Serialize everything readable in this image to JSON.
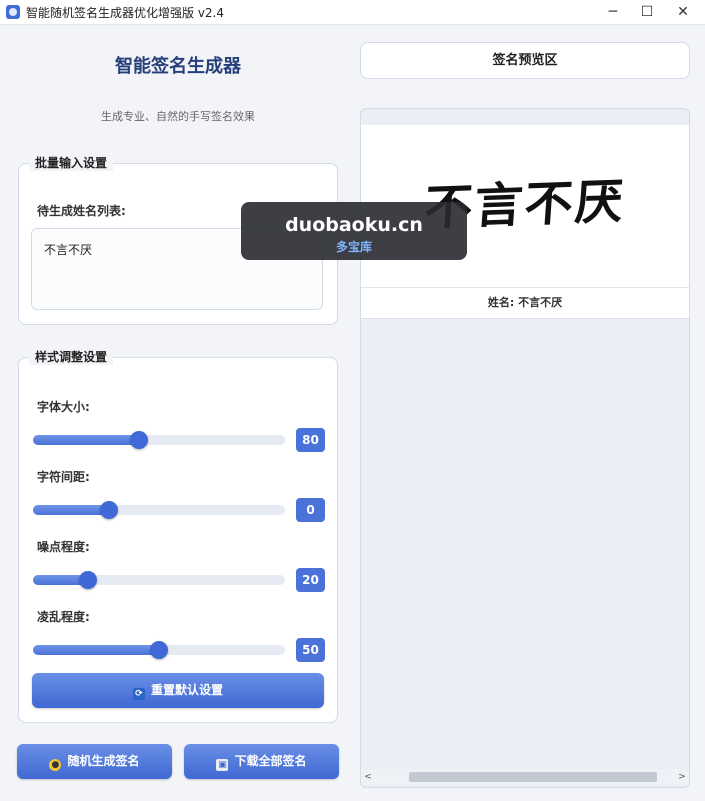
{
  "window": {
    "title": "智能随机签名生成器优化增强版 v2.4",
    "controls": {
      "minimize": "─",
      "maximize": "☐",
      "close": "✕"
    }
  },
  "header": {
    "title": "智能签名生成器",
    "subtitle": "生成专业、自然的手写签名效果"
  },
  "batch_input": {
    "group_title": "批量输入设置",
    "label": "待生成姓名列表:",
    "value": "不言不厌"
  },
  "style_settings": {
    "group_title": "样式调整设置",
    "sliders": [
      {
        "label": "字体大小:",
        "value": "80",
        "fraction": 0.42
      },
      {
        "label": "字符间距:",
        "value": "0",
        "fraction": 0.3
      },
      {
        "label": "噪点程度:",
        "value": "20",
        "fraction": 0.22
      },
      {
        "label": "凌乱程度:",
        "value": "50",
        "fraction": 0.5
      }
    ],
    "reset_label": "重置默认设置"
  },
  "actions": {
    "random_label": "随机生成签名",
    "download_label": "下载全部签名"
  },
  "preview": {
    "header": "签名预览区",
    "signature_text": "不言不厌",
    "name_caption": "姓名: 不言不厌",
    "scroll_left": "<",
    "scroll_right": ">"
  },
  "watermark": {
    "main": "duobaoku.cn",
    "sub": "多宝库"
  },
  "colors": {
    "accent": "#4a72d8",
    "title": "#27407a",
    "background": "#f2f4f8"
  }
}
